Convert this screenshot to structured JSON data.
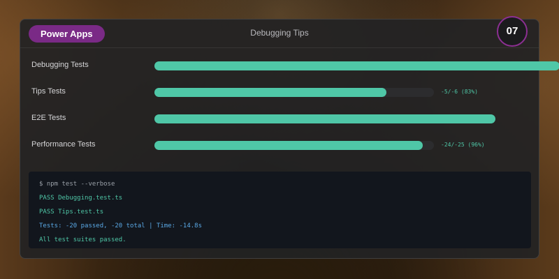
{
  "header": {
    "brand": "Power Apps",
    "title": "Debugging Tips",
    "step": "07"
  },
  "rows": [
    {
      "label": "Debugging Tests",
      "progress": 1.0,
      "stat": ""
    },
    {
      "label": "Tips Tests",
      "progress": 0.83,
      "stat": "-5/-6 (83%)"
    },
    {
      "label": "E2E Tests",
      "progress": 1.0,
      "stat": ""
    },
    {
      "label": "Performance Tests",
      "progress": 0.96,
      "stat": "-24/-25 (96%)"
    }
  ],
  "terminal": {
    "lines": [
      {
        "text": "$ npm test --verbose",
        "kind": "command"
      },
      {
        "text": "PASS Debugging.test.ts",
        "kind": "pass"
      },
      {
        "text": "PASS Tips.test.ts",
        "kind": "pass"
      },
      {
        "text": "Tests: -20 passed, -20 total | Time: -14.8s",
        "kind": "summary"
      },
      {
        "text": "All test suites passed.",
        "kind": "pass"
      }
    ]
  },
  "colors": {
    "accent": "#4fc7a7",
    "brand": "#7a2a86",
    "command": "#9aa0a8",
    "summary": "#5aa9e6"
  }
}
